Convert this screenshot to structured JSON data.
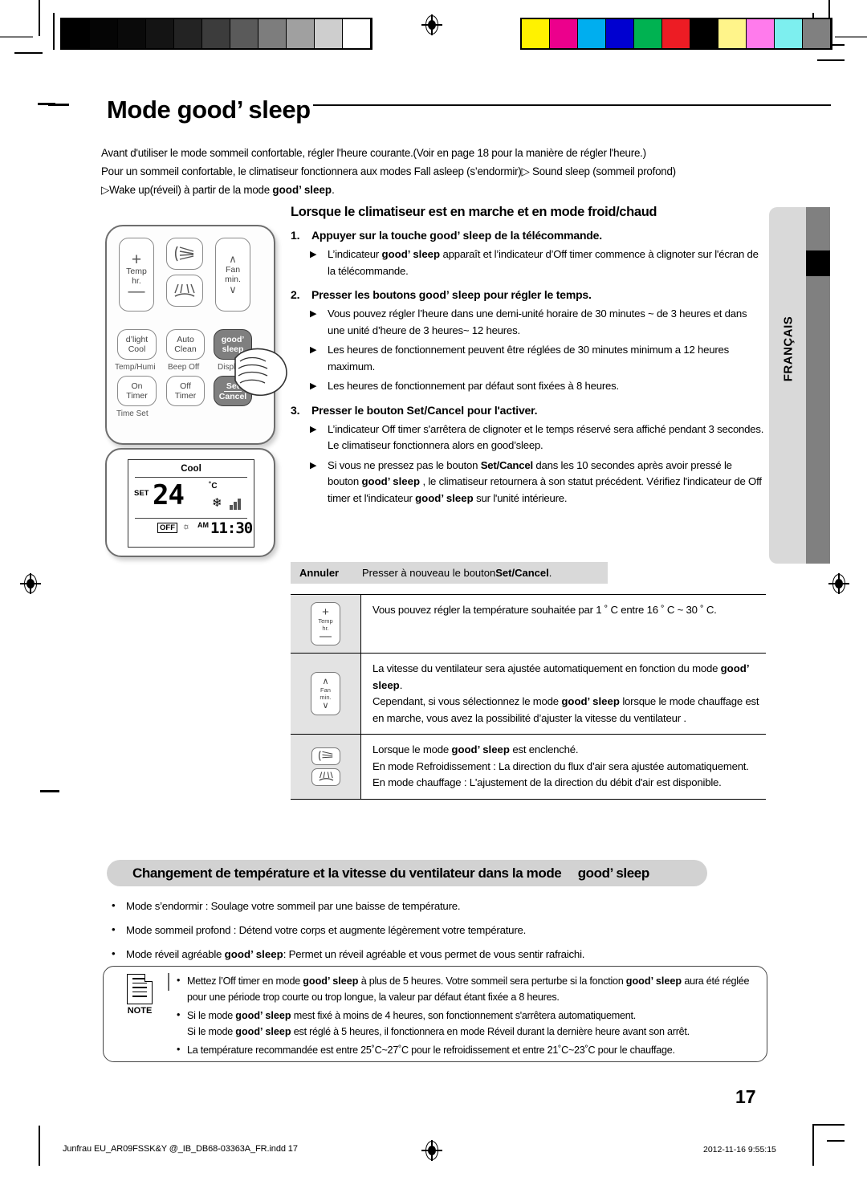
{
  "document": {
    "title": "Mode good' sleep",
    "title_main": "Mode ",
    "title_brand": "good’ sleep",
    "language_tab": "FRANÇAIS",
    "page_number": "17",
    "footer_left": "Junfrau EU_AR09FSSK&Y @_IB_DB68-03363A_FR.indd   17",
    "footer_right": "2012-11-16   9:55:15"
  },
  "intro": {
    "line1": "Avant d'utiliser le mode sommeil confortable, régler l'heure courante.(Voir en page 18 pour la manière de régler l'heure.)",
    "line2": "Pour un sommeil confortable, le climatiseur fonctionnera aux modes Fall asleep (s’endormir)▷ Sound sleep (sommeil profond)",
    "line3_a": "▷Wake up(réveil) à partir de la mode ",
    "line3_b": "good’ sleep",
    "line3_c": "."
  },
  "remote": {
    "buttons": [
      {
        "name": "temp-up",
        "label": "+"
      },
      {
        "name": "temp-label",
        "label": "Temp"
      },
      {
        "name": "hr-label",
        "label": "hr."
      },
      {
        "name": "temp-down",
        "label": "–"
      },
      {
        "name": "fan-label",
        "label": "Fan"
      },
      {
        "name": "min-label",
        "label": "min."
      },
      {
        "name": "dlight-cool",
        "label": "d’light\nCool"
      },
      {
        "name": "auto-clean",
        "label": "Auto\nClean"
      },
      {
        "name": "good-sleep",
        "label": "good’\nsleep"
      },
      {
        "name": "on-timer",
        "label": "On\nTimer"
      },
      {
        "name": "off-timer",
        "label": "Off\nTimer"
      },
      {
        "name": "set-cancel",
        "label": "Set\nCancel"
      }
    ],
    "b_dlight_1": "d’light",
    "b_dlight_2": "Cool",
    "b_auto_1": "Auto",
    "b_auto_2": "Clean",
    "b_good_1": "good’",
    "b_good_2": "sleep",
    "b_on_1": "On",
    "b_on_2": "Timer",
    "b_off_1": "Off",
    "b_off_2": "Timer",
    "b_set_1": "Set",
    "b_set_2": "Cancel",
    "b_temp": "Temp",
    "b_hr": "hr.",
    "b_fan": "Fan",
    "b_min": "min.",
    "b_plus": "+",
    "b_minus": "—",
    "sub_temphumi": "Temp/Humi",
    "sub_beepoff": "Beep Off",
    "sub_display": "Display",
    "sub_timeset": "Time Set"
  },
  "lcd": {
    "mode": "Cool",
    "set_label": "SET",
    "temperature": "24",
    "degree": "˚C",
    "off_badge": "OFF",
    "am": "AM",
    "time": "11:30"
  },
  "section": {
    "heading": "Lorsque le climatiseur est en marche et en mode froid/chaud",
    "steps": [
      {
        "num": "1.",
        "text_a": "Appuyer sur la touche ",
        "brand": "good’ sleep",
        "text_b": " de la télécommande.",
        "bullets": [
          {
            "a": "L’indicateur ",
            "brand": "good’ sleep",
            "b": " apparaît et  l’indicateur d’Off timer commence à clignoter sur l'écran de la télécommande."
          }
        ]
      },
      {
        "num": "2.",
        "text_a": "Presser les boutons ",
        "brand": "good’ sleep",
        "text_b": " pour régler le temps.",
        "bullets": [
          {
            "a": "Vous pouvez régler l’heure dans une demi-unité horaire de 30 minutes ~ de 3 heures et dans une unité d’heure de 3 heures~ 12 heures.",
            "brand": "",
            "b": ""
          },
          {
            "a": "Les heures de fonctionnement peuvent être réglées de 30 minutes minimum a 12 heures maximum.",
            "brand": "",
            "b": ""
          },
          {
            "a": "Les heures de fonctionnement par défaut sont fixées à 8 heures.",
            "brand": "",
            "b": ""
          }
        ]
      },
      {
        "num": "3.",
        "text_a": "Presser le bouton ",
        "brand": "Set/Cancel",
        "text_b": " pour l'activer.",
        "bullets": [
          {
            "a": "L’indicateur Off timer s'arrêtera de clignoter et le temps réservé sera affiché pendant 3 secondes.",
            "brand": "",
            "b": "",
            "extra": "Le climatiseur fonctionnera alors en good’sleep."
          },
          {
            "a": "Si vous ne pressez pas le bouton ",
            "brand": "Set/Cancel",
            "b": " dans les 10 secondes après avoir pressé le bouton ",
            "brand2": "good’ sleep",
            "c": " , le climatiseur retournera  à son statut précédent. Vérifiez l'indicateur de Off timer et l'indicateur ",
            "brand3": "good’ sleep",
            "d": " sur l'unité intérieure."
          }
        ]
      }
    ]
  },
  "cancel_bar": {
    "label": "Annuler",
    "text_a": "Presser à nouveau le bouton ",
    "brand": "Set/Cancel",
    "text_b": "."
  },
  "table": {
    "rows": [
      {
        "icon": "temp-stepper-icon",
        "icon_top": "+",
        "icon_mid1": "Temp",
        "icon_mid2": "hr.",
        "icon_bot": "—",
        "paras": [
          {
            "a": "Vous pouvez régler la température souhaitée par 1 ˚ C entre 16 ˚ C ~ 30 ˚ C.",
            "brand": "",
            "b": ""
          }
        ]
      },
      {
        "icon": "fan-stepper-icon",
        "icon_top": "∧",
        "icon_mid1": "Fan",
        "icon_mid2": "min.",
        "icon_bot": "∨",
        "paras": [
          {
            "a": "La vitesse du ventilateur sera ajustée automatiquement en fonction du mode ",
            "brand": "good’ sleep",
            "b": "."
          },
          {
            "a": "Cependant, si vous sélectionnez le mode ",
            "brand": "good’ sleep",
            "b": " lorsque le mode chauffage est en marche, vous avez la possibilité d’ajuster la vitesse du ventilateur ."
          }
        ]
      },
      {
        "icon": "airflow-direction-icon",
        "paras": [
          {
            "a": "Lorsque le mode ",
            "brand": "good’ sleep",
            "b": " est enclenché."
          },
          {
            "a": "En mode Refroidissement : La direction du flux d’air sera ajustée automatiquement.",
            "brand": "",
            "b": ""
          },
          {
            "a": "En mode chauffage : L'ajustement de la direction du débit d'air est disponible.",
            "brand": "",
            "b": ""
          }
        ]
      }
    ]
  },
  "bottom": {
    "heading_a": "Changement de température et la vitesse du ventilateur dans la mode ",
    "heading_brand": "good’ sleep",
    "bullets": [
      {
        "a": "Mode s’endormir : Soulage votre sommeil par une baisse de température.",
        "brand": "",
        "b": ""
      },
      {
        "a": "Mode sommeil profond : Détend votre corps et augmente légèrement votre température.",
        "brand": "",
        "b": ""
      },
      {
        "a": "Mode réveil agréable ",
        "brand": "good’ sleep",
        "b": ": Permet un réveil agréable et vous permet de vous sentir rafraichi."
      }
    ]
  },
  "note": {
    "caption": "NOTE",
    "items": [
      {
        "a": " Mettez l’Off timer en mode ",
        "brand": "good’ sleep",
        "b": " à plus de 5 heures. Votre sommeil sera perturbe si la fonction ",
        "brand2": "good’ sleep",
        "c": " aura été réglée pour une période trop courte ou trop longue, la valeur par défaut étant fixée a 8 heures."
      },
      {
        "a": "Si le mode ",
        "brand": "good’ sleep",
        "b": " mest fixé à moins de 4 heures, son fonctionnement s'arrêtera automatiquement.",
        "line2_a": "Si le mode ",
        "line2_brand": "good’ sleep",
        "line2_b": " est réglé à 5 heures, il fonctionnera en mode Réveil durant la dernière heure avant son arrêt."
      },
      {
        "a": "La température recommandée est entre 25˚C~27˚C pour le refroidissement et entre 21˚C~23˚C pour le chauffage.",
        "brand": "",
        "b": ""
      }
    ]
  },
  "print_marks": {
    "grayscale": [
      "#000000",
      "#050505",
      "#0a0a0a",
      "#141414",
      "#232323",
      "#3c3c3c",
      "#5a5a5a",
      "#7d7d7d",
      "#a0a0a0",
      "#cecece",
      "#ffffff"
    ],
    "colors": [
      "#fff200",
      "#ec008c",
      "#00aeef",
      "#0000d0",
      "#00b251",
      "#ed1c24",
      "#000000",
      "#fff48a",
      "#ff7bec",
      "#7defef",
      "#808080"
    ]
  }
}
